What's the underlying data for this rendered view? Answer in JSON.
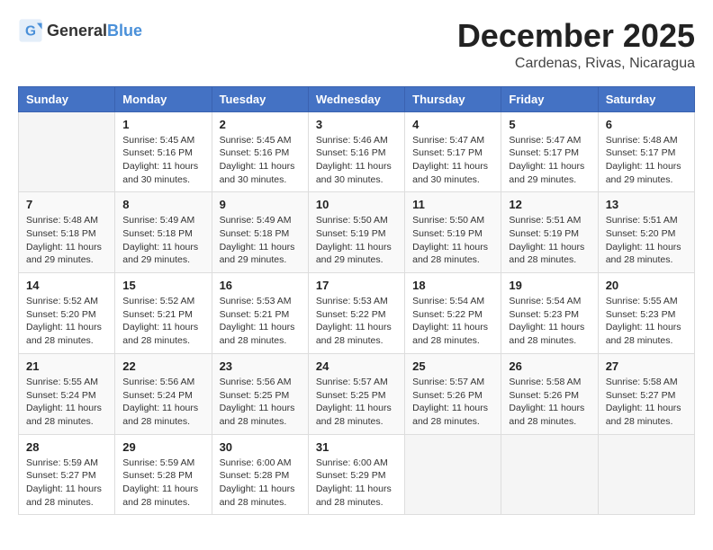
{
  "header": {
    "logo": {
      "text_general": "General",
      "text_blue": "Blue"
    },
    "title": "December 2025",
    "location": "Cardenas, Rivas, Nicaragua"
  },
  "days_of_week": [
    "Sunday",
    "Monday",
    "Tuesday",
    "Wednesday",
    "Thursday",
    "Friday",
    "Saturday"
  ],
  "weeks": [
    [
      {
        "day": "",
        "sunrise": "",
        "sunset": "",
        "daylight": ""
      },
      {
        "day": "1",
        "sunrise": "Sunrise: 5:45 AM",
        "sunset": "Sunset: 5:16 PM",
        "daylight": "Daylight: 11 hours and 30 minutes."
      },
      {
        "day": "2",
        "sunrise": "Sunrise: 5:45 AM",
        "sunset": "Sunset: 5:16 PM",
        "daylight": "Daylight: 11 hours and 30 minutes."
      },
      {
        "day": "3",
        "sunrise": "Sunrise: 5:46 AM",
        "sunset": "Sunset: 5:16 PM",
        "daylight": "Daylight: 11 hours and 30 minutes."
      },
      {
        "day": "4",
        "sunrise": "Sunrise: 5:47 AM",
        "sunset": "Sunset: 5:17 PM",
        "daylight": "Daylight: 11 hours and 30 minutes."
      },
      {
        "day": "5",
        "sunrise": "Sunrise: 5:47 AM",
        "sunset": "Sunset: 5:17 PM",
        "daylight": "Daylight: 11 hours and 29 minutes."
      },
      {
        "day": "6",
        "sunrise": "Sunrise: 5:48 AM",
        "sunset": "Sunset: 5:17 PM",
        "daylight": "Daylight: 11 hours and 29 minutes."
      }
    ],
    [
      {
        "day": "7",
        "sunrise": "Sunrise: 5:48 AM",
        "sunset": "Sunset: 5:18 PM",
        "daylight": "Daylight: 11 hours and 29 minutes."
      },
      {
        "day": "8",
        "sunrise": "Sunrise: 5:49 AM",
        "sunset": "Sunset: 5:18 PM",
        "daylight": "Daylight: 11 hours and 29 minutes."
      },
      {
        "day": "9",
        "sunrise": "Sunrise: 5:49 AM",
        "sunset": "Sunset: 5:18 PM",
        "daylight": "Daylight: 11 hours and 29 minutes."
      },
      {
        "day": "10",
        "sunrise": "Sunrise: 5:50 AM",
        "sunset": "Sunset: 5:19 PM",
        "daylight": "Daylight: 11 hours and 29 minutes."
      },
      {
        "day": "11",
        "sunrise": "Sunrise: 5:50 AM",
        "sunset": "Sunset: 5:19 PM",
        "daylight": "Daylight: 11 hours and 28 minutes."
      },
      {
        "day": "12",
        "sunrise": "Sunrise: 5:51 AM",
        "sunset": "Sunset: 5:19 PM",
        "daylight": "Daylight: 11 hours and 28 minutes."
      },
      {
        "day": "13",
        "sunrise": "Sunrise: 5:51 AM",
        "sunset": "Sunset: 5:20 PM",
        "daylight": "Daylight: 11 hours and 28 minutes."
      }
    ],
    [
      {
        "day": "14",
        "sunrise": "Sunrise: 5:52 AM",
        "sunset": "Sunset: 5:20 PM",
        "daylight": "Daylight: 11 hours and 28 minutes."
      },
      {
        "day": "15",
        "sunrise": "Sunrise: 5:52 AM",
        "sunset": "Sunset: 5:21 PM",
        "daylight": "Daylight: 11 hours and 28 minutes."
      },
      {
        "day": "16",
        "sunrise": "Sunrise: 5:53 AM",
        "sunset": "Sunset: 5:21 PM",
        "daylight": "Daylight: 11 hours and 28 minutes."
      },
      {
        "day": "17",
        "sunrise": "Sunrise: 5:53 AM",
        "sunset": "Sunset: 5:22 PM",
        "daylight": "Daylight: 11 hours and 28 minutes."
      },
      {
        "day": "18",
        "sunrise": "Sunrise: 5:54 AM",
        "sunset": "Sunset: 5:22 PM",
        "daylight": "Daylight: 11 hours and 28 minutes."
      },
      {
        "day": "19",
        "sunrise": "Sunrise: 5:54 AM",
        "sunset": "Sunset: 5:23 PM",
        "daylight": "Daylight: 11 hours and 28 minutes."
      },
      {
        "day": "20",
        "sunrise": "Sunrise: 5:55 AM",
        "sunset": "Sunset: 5:23 PM",
        "daylight": "Daylight: 11 hours and 28 minutes."
      }
    ],
    [
      {
        "day": "21",
        "sunrise": "Sunrise: 5:55 AM",
        "sunset": "Sunset: 5:24 PM",
        "daylight": "Daylight: 11 hours and 28 minutes."
      },
      {
        "day": "22",
        "sunrise": "Sunrise: 5:56 AM",
        "sunset": "Sunset: 5:24 PM",
        "daylight": "Daylight: 11 hours and 28 minutes."
      },
      {
        "day": "23",
        "sunrise": "Sunrise: 5:56 AM",
        "sunset": "Sunset: 5:25 PM",
        "daylight": "Daylight: 11 hours and 28 minutes."
      },
      {
        "day": "24",
        "sunrise": "Sunrise: 5:57 AM",
        "sunset": "Sunset: 5:25 PM",
        "daylight": "Daylight: 11 hours and 28 minutes."
      },
      {
        "day": "25",
        "sunrise": "Sunrise: 5:57 AM",
        "sunset": "Sunset: 5:26 PM",
        "daylight": "Daylight: 11 hours and 28 minutes."
      },
      {
        "day": "26",
        "sunrise": "Sunrise: 5:58 AM",
        "sunset": "Sunset: 5:26 PM",
        "daylight": "Daylight: 11 hours and 28 minutes."
      },
      {
        "day": "27",
        "sunrise": "Sunrise: 5:58 AM",
        "sunset": "Sunset: 5:27 PM",
        "daylight": "Daylight: 11 hours and 28 minutes."
      }
    ],
    [
      {
        "day": "28",
        "sunrise": "Sunrise: 5:59 AM",
        "sunset": "Sunset: 5:27 PM",
        "daylight": "Daylight: 11 hours and 28 minutes."
      },
      {
        "day": "29",
        "sunrise": "Sunrise: 5:59 AM",
        "sunset": "Sunset: 5:28 PM",
        "daylight": "Daylight: 11 hours and 28 minutes."
      },
      {
        "day": "30",
        "sunrise": "Sunrise: 6:00 AM",
        "sunset": "Sunset: 5:28 PM",
        "daylight": "Daylight: 11 hours and 28 minutes."
      },
      {
        "day": "31",
        "sunrise": "Sunrise: 6:00 AM",
        "sunset": "Sunset: 5:29 PM",
        "daylight": "Daylight: 11 hours and 28 minutes."
      },
      {
        "day": "",
        "sunrise": "",
        "sunset": "",
        "daylight": ""
      },
      {
        "day": "",
        "sunrise": "",
        "sunset": "",
        "daylight": ""
      },
      {
        "day": "",
        "sunrise": "",
        "sunset": "",
        "daylight": ""
      }
    ]
  ]
}
